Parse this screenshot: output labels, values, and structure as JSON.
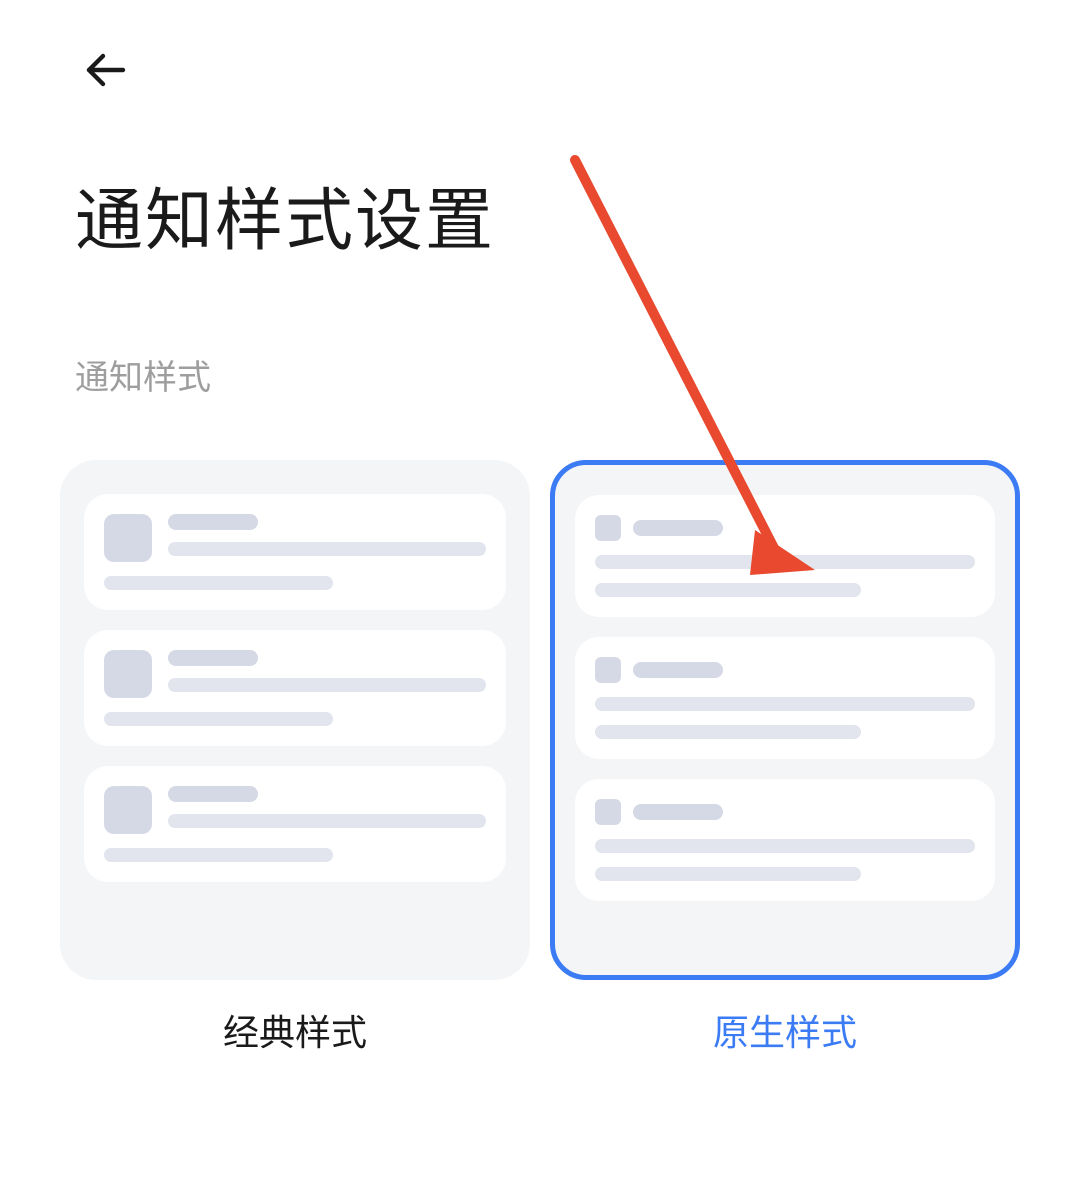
{
  "header": {
    "page_title": "通知样式设置"
  },
  "section": {
    "label": "通知样式"
  },
  "options": {
    "classic": {
      "label": "经典样式",
      "selected": false
    },
    "native": {
      "label": "原生样式",
      "selected": true
    }
  },
  "colors": {
    "accent": "#3b7cf5",
    "annotation": "#e8492f"
  }
}
